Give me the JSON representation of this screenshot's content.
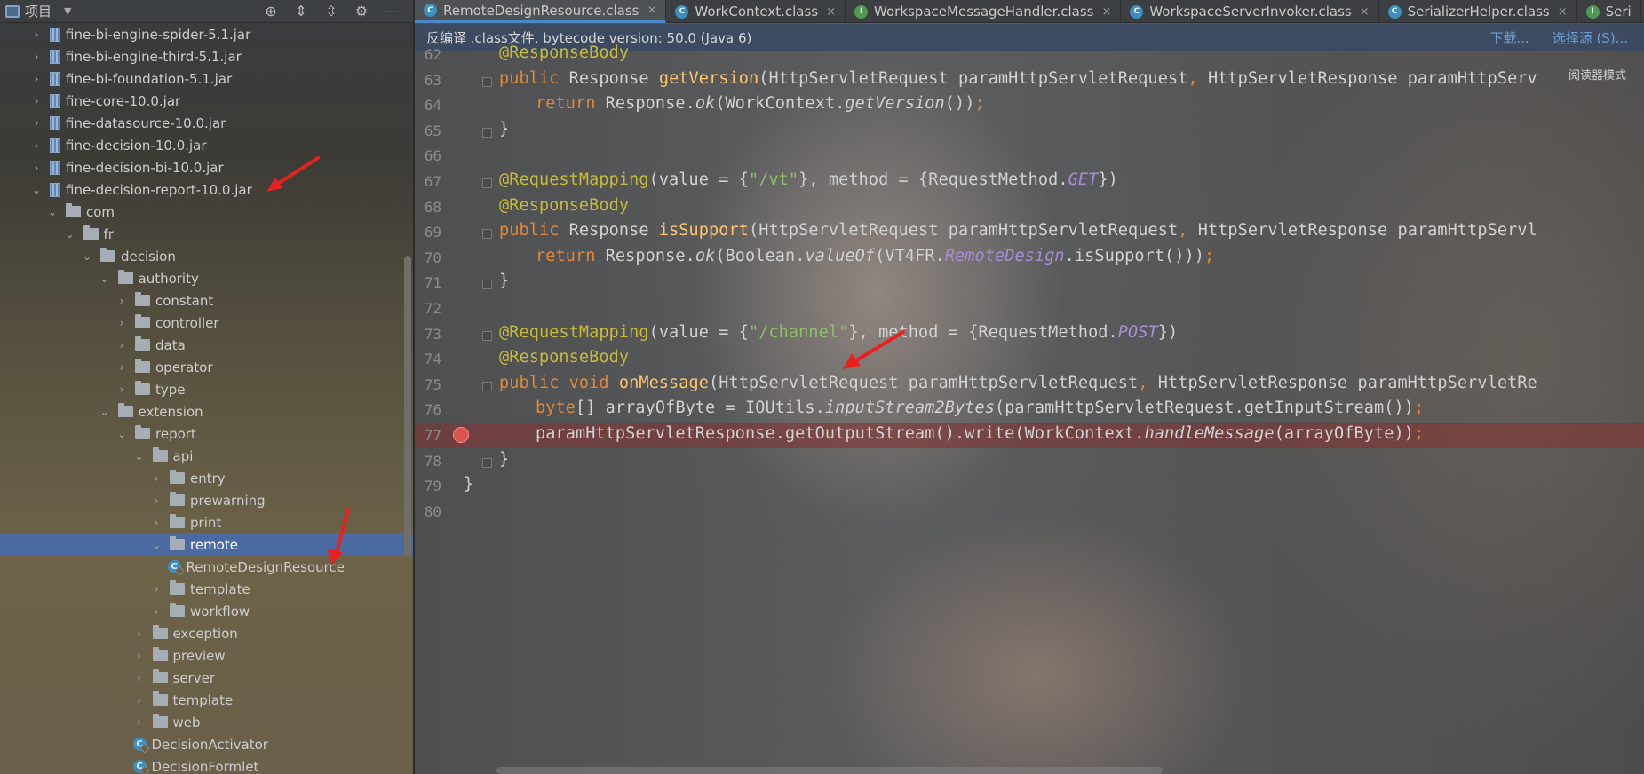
{
  "project_panel": {
    "title": "项目",
    "tree": [
      {
        "label": "fine-bi-engine-spider-5.1.jar",
        "type": "jar",
        "depth": 0,
        "expanded": false
      },
      {
        "label": "fine-bi-engine-third-5.1.jar",
        "type": "jar",
        "depth": 0,
        "expanded": false
      },
      {
        "label": "fine-bi-foundation-5.1.jar",
        "type": "jar",
        "depth": 0,
        "expanded": false
      },
      {
        "label": "fine-core-10.0.jar",
        "type": "jar",
        "depth": 0,
        "expanded": false
      },
      {
        "label": "fine-datasource-10.0.jar",
        "type": "jar",
        "depth": 0,
        "expanded": false
      },
      {
        "label": "fine-decision-10.0.jar",
        "type": "jar",
        "depth": 0,
        "expanded": false
      },
      {
        "label": "fine-decision-bi-10.0.jar",
        "type": "jar",
        "depth": 0,
        "expanded": false
      },
      {
        "label": "fine-decision-report-10.0.jar",
        "type": "jar",
        "depth": 0,
        "expanded": true
      },
      {
        "label": "com",
        "type": "folder",
        "depth": 1,
        "expanded": true
      },
      {
        "label": "fr",
        "type": "folder",
        "depth": 2,
        "expanded": true
      },
      {
        "label": "decision",
        "type": "folder",
        "depth": 3,
        "expanded": true
      },
      {
        "label": "authority",
        "type": "folder",
        "depth": 4,
        "expanded": true
      },
      {
        "label": "constant",
        "type": "folder",
        "depth": 5,
        "expanded": false
      },
      {
        "label": "controller",
        "type": "folder",
        "depth": 5,
        "expanded": false
      },
      {
        "label": "data",
        "type": "folder",
        "depth": 5,
        "expanded": false
      },
      {
        "label": "operator",
        "type": "folder",
        "depth": 5,
        "expanded": false
      },
      {
        "label": "type",
        "type": "folder",
        "depth": 5,
        "expanded": false
      },
      {
        "label": "extension",
        "type": "folder",
        "depth": 4,
        "expanded": true
      },
      {
        "label": "report",
        "type": "folder",
        "depth": 5,
        "expanded": true
      },
      {
        "label": "api",
        "type": "folder",
        "depth": 6,
        "expanded": true
      },
      {
        "label": "entry",
        "type": "folder",
        "depth": 7,
        "expanded": false
      },
      {
        "label": "prewarning",
        "type": "folder",
        "depth": 7,
        "expanded": false
      },
      {
        "label": "print",
        "type": "folder",
        "depth": 7,
        "expanded": false
      },
      {
        "label": "remote",
        "type": "folder",
        "depth": 7,
        "expanded": true,
        "selected": true
      },
      {
        "label": "RemoteDesignResource",
        "type": "class",
        "depth": 8,
        "expanded": null
      },
      {
        "label": "template",
        "type": "folder",
        "depth": 7,
        "expanded": false
      },
      {
        "label": "workflow",
        "type": "folder",
        "depth": 7,
        "expanded": false
      },
      {
        "label": "exception",
        "type": "folder",
        "depth": 6,
        "expanded": false
      },
      {
        "label": "preview",
        "type": "folder",
        "depth": 6,
        "expanded": false
      },
      {
        "label": "server",
        "type": "folder",
        "depth": 6,
        "expanded": false
      },
      {
        "label": "template",
        "type": "folder",
        "depth": 6,
        "expanded": false
      },
      {
        "label": "web",
        "type": "folder",
        "depth": 6,
        "expanded": false
      },
      {
        "label": "DecisionActivator",
        "type": "class",
        "depth": 6,
        "expanded": null
      },
      {
        "label": "DecisionFormlet",
        "type": "class",
        "depth": 6,
        "expanded": null
      }
    ]
  },
  "editor": {
    "tabs": [
      {
        "label": "RemoteDesignResource.class",
        "icon": "class-icon",
        "active": true
      },
      {
        "label": "WorkContext.class",
        "icon": "class-icon",
        "active": false
      },
      {
        "label": "WorkspaceMessageHandler.class",
        "icon": "interface-icon",
        "active": false
      },
      {
        "label": "WorkspaceServerInvoker.class",
        "icon": "class-icon",
        "active": false
      },
      {
        "label": "SerializerHelper.class",
        "icon": "class-icon",
        "active": false
      },
      {
        "label": "Seri",
        "icon": "interface-icon",
        "active": false
      }
    ],
    "info_bar": {
      "text": "反编译 .class文件, bytecode version: 50.0 (Java 6)",
      "download": "下载...",
      "choose_source": "选择源 (S)..."
    },
    "reader_mode": "阅读器模式",
    "breakpoint_line": "77",
    "lines": [
      {
        "num": "62",
        "segments": [
          {
            "t": "@ResponseBody",
            "c": "ann"
          }
        ]
      },
      {
        "num": "63",
        "segments": [
          {
            "t": "public ",
            "c": "kw"
          },
          {
            "t": "Response "
          },
          {
            "t": "getVersion",
            "c": "fn"
          },
          {
            "t": "(HttpServletRequest paramHttpServletRequest"
          },
          {
            "t": ", ",
            "c": "kw"
          },
          {
            "t": "HttpServletResponse paramHttpServ"
          }
        ]
      },
      {
        "num": "64",
        "indent": 1,
        "segments": [
          {
            "t": "return ",
            "c": "kw"
          },
          {
            "t": "Response."
          },
          {
            "t": "ok",
            "c": "it"
          },
          {
            "t": "(WorkContext."
          },
          {
            "t": "getVersion",
            "c": "it"
          },
          {
            "t": "())"
          },
          {
            "t": ";",
            "c": "kw"
          }
        ]
      },
      {
        "num": "65",
        "segments": [
          {
            "t": "}"
          }
        ]
      },
      {
        "num": "66",
        "segments": []
      },
      {
        "num": "67",
        "segments": [
          {
            "t": "@RequestMapping",
            "c": "ann"
          },
          {
            "t": "(value = {"
          },
          {
            "t": "\"/vt\"",
            "c": "str"
          },
          {
            "t": "}, method = {RequestMethod."
          },
          {
            "t": "GET",
            "c": "const"
          },
          {
            "t": "})"
          }
        ]
      },
      {
        "num": "68",
        "segments": [
          {
            "t": "@ResponseBody",
            "c": "ann"
          }
        ]
      },
      {
        "num": "69",
        "segments": [
          {
            "t": "public ",
            "c": "kw"
          },
          {
            "t": "Response "
          },
          {
            "t": "isSupport",
            "c": "fn"
          },
          {
            "t": "(HttpServletRequest paramHttpServletRequest"
          },
          {
            "t": ", ",
            "c": "kw"
          },
          {
            "t": "HttpServletResponse paramHttpServl"
          }
        ]
      },
      {
        "num": "70",
        "indent": 1,
        "segments": [
          {
            "t": "return ",
            "c": "kw"
          },
          {
            "t": "Response."
          },
          {
            "t": "ok",
            "c": "it"
          },
          {
            "t": "(Boolean."
          },
          {
            "t": "valueOf",
            "c": "it"
          },
          {
            "t": "(VT4FR."
          },
          {
            "t": "RemoteDesign",
            "c": "const"
          },
          {
            "t": ".isSupport()))"
          },
          {
            "t": ";",
            "c": "kw"
          }
        ]
      },
      {
        "num": "71",
        "segments": [
          {
            "t": "}"
          }
        ]
      },
      {
        "num": "72",
        "segments": []
      },
      {
        "num": "73",
        "segments": [
          {
            "t": "@RequestMapping",
            "c": "ann"
          },
          {
            "t": "(value = {"
          },
          {
            "t": "\"/channel\"",
            "c": "str"
          },
          {
            "t": "}, method = {RequestMethod."
          },
          {
            "t": "POST",
            "c": "const"
          },
          {
            "t": "})"
          }
        ]
      },
      {
        "num": "74",
        "segments": [
          {
            "t": "@ResponseBody",
            "c": "ann"
          }
        ]
      },
      {
        "num": "75",
        "segments": [
          {
            "t": "public void ",
            "c": "kw"
          },
          {
            "t": "onMessage",
            "c": "fn"
          },
          {
            "t": "(HttpServletRequest paramHttpServletRequest"
          },
          {
            "t": ", ",
            "c": "kw"
          },
          {
            "t": "HttpServletResponse paramHttpServletRe"
          }
        ]
      },
      {
        "num": "76",
        "indent": 1,
        "segments": [
          {
            "t": "byte",
            "c": "kw"
          },
          {
            "t": "[] arrayOfByte = IOUtils."
          },
          {
            "t": "inputStream2Bytes",
            "c": "it"
          },
          {
            "t": "(paramHttpServletRequest.getInputStream())"
          },
          {
            "t": ";",
            "c": "kw"
          }
        ]
      },
      {
        "num": "77",
        "indent": 1,
        "segments": [
          {
            "t": "paramHttpServletResponse.getOutputStream().write(WorkContext."
          },
          {
            "t": "handleMessage",
            "c": "it"
          },
          {
            "t": "(arrayOfByte))"
          },
          {
            "t": ";",
            "c": "kw"
          }
        ]
      },
      {
        "num": "78",
        "segments": [
          {
            "t": "}"
          }
        ]
      },
      {
        "num": "79",
        "outdent": true,
        "segments": [
          {
            "t": "}"
          }
        ]
      },
      {
        "num": "80",
        "segments": []
      }
    ]
  },
  "colors": {
    "selection": "#4a6aa1",
    "breakpoint": "#d9534f",
    "arrow": "#e8211e",
    "keyword": "#e0893a",
    "annotation": "#c7bc3a",
    "method": "#ffc66d",
    "string": "#8fbf6d"
  }
}
